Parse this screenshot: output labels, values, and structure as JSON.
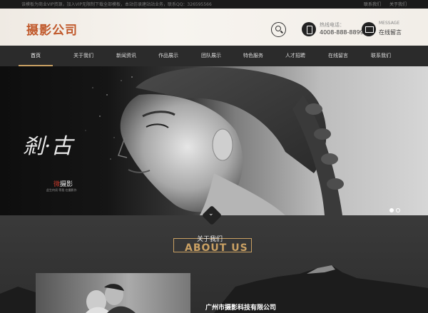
{
  "topbar": {
    "notice": "该模板为商业VIP资源，加入VIP无限制下载全部模板，本站仿录建站站业务，联系QQ：326595566",
    "links": [
      "联系我们",
      "关于我们"
    ]
  },
  "header": {
    "logo": "摄影公司",
    "hotline_label": "热线电话：",
    "hotline_number": "4008-888-8899",
    "message_en": "MESSAGE",
    "message_cn": "在线留言"
  },
  "nav": {
    "items": [
      "首页",
      "关于我们",
      "新闻资讯",
      "作品展示",
      "团队展示",
      "特色服务",
      "人才招聘",
      "在线留言",
      "联系我们"
    ],
    "active_index": 0
  },
  "banner": {
    "calligraphy": "剎·古",
    "subtitle_red": "微",
    "subtitle": "摄影",
    "small_text": "此生何须 等我 在摄影作",
    "slide_count": 2,
    "active_slide": 0
  },
  "about": {
    "title_cn": "关于我们",
    "title_en": "ABOUT US",
    "company_name": "广州市摄影科技有限公司"
  },
  "colors": {
    "accent": "#c9a063",
    "logo": "#c0582a",
    "nav_bg": "#2b2b2b"
  }
}
